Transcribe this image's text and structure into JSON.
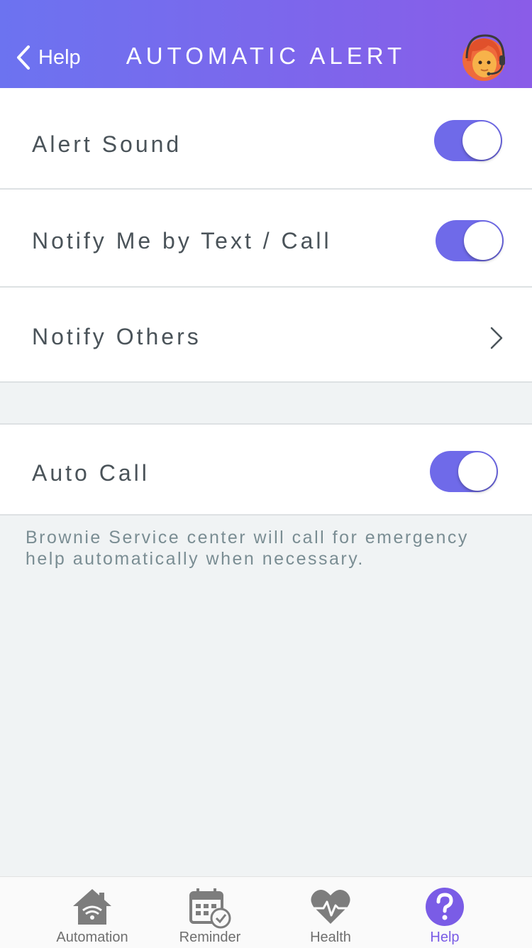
{
  "header": {
    "back_label": "Help",
    "title": "AUTOMATIC ALERT",
    "avatar_icon": "support-agent-avatar-icon"
  },
  "settings": {
    "alert_sound": {
      "label": "Alert Sound",
      "enabled": true
    },
    "notify_me": {
      "label": "Notify Me by Text / Call",
      "enabled": true
    },
    "notify_others": {
      "label": "Notify Others",
      "icon": "chevron-right-icon"
    },
    "auto_call": {
      "label": "Auto Call",
      "enabled": true
    }
  },
  "note": "Brownie Service center will call for emergency help automatically when necessary.",
  "tabbar": {
    "items": [
      {
        "label": "Automation",
        "icon": "smart-home-icon",
        "active": false
      },
      {
        "label": "Reminder",
        "icon": "calendar-check-icon",
        "active": false
      },
      {
        "label": "Health",
        "icon": "heart-pulse-icon",
        "active": false
      },
      {
        "label": "Help",
        "icon": "question-circle-icon",
        "active": true
      }
    ]
  },
  "colors": {
    "header_gradient_start": "#6c73f0",
    "header_gradient_end": "#8a5ce8",
    "toggle_on": "#6f6ae9",
    "active_tab": "#7a5ce6",
    "inactive_tab": "#6f6f6f"
  }
}
